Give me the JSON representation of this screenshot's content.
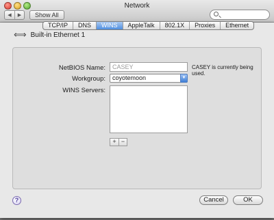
{
  "window": {
    "title": "Network"
  },
  "toolbar": {
    "back_label": "◀",
    "forward_label": "▶",
    "show_all_label": "Show All",
    "search_placeholder": ""
  },
  "sheet": {
    "interface_label": "Built-in Ethernet 1",
    "tabs": [
      {
        "label": "TCP/IP",
        "active": false
      },
      {
        "label": "DNS",
        "active": false
      },
      {
        "label": "WINS",
        "active": true
      },
      {
        "label": "AppleTalk",
        "active": false
      },
      {
        "label": "802.1X",
        "active": false
      },
      {
        "label": "Proxies",
        "active": false
      },
      {
        "label": "Ethernet",
        "active": false
      }
    ],
    "netbios_label": "NetBIOS Name:",
    "netbios_value": "CASEY",
    "netbios_note": "CASEY is currently being used.",
    "workgroup_label": "Workgroup:",
    "workgroup_value": "coyotemoon",
    "wins_servers_label": "WINS Servers:",
    "add_label": "+",
    "remove_label": "−",
    "help_label": "?",
    "cancel_label": "Cancel",
    "ok_label": "OK"
  }
}
